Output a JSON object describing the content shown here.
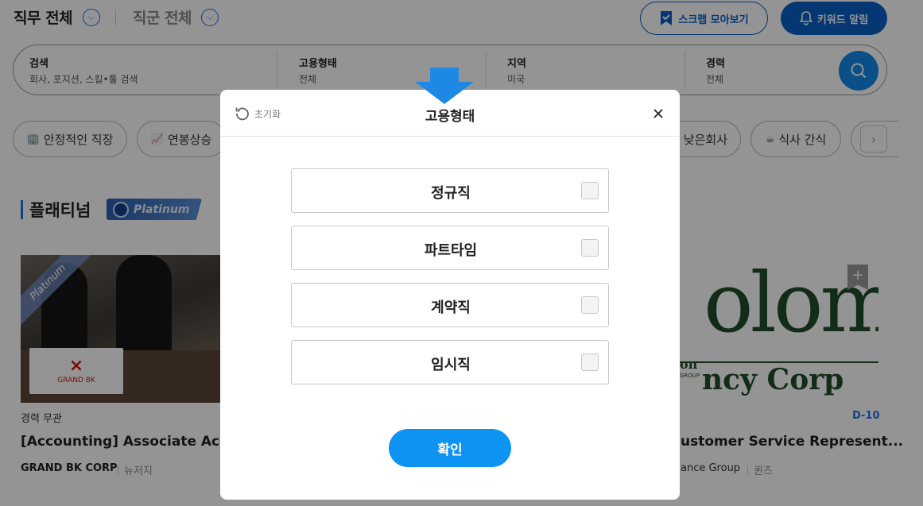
{
  "header": {
    "job_filter": "직무 전체",
    "group_filter": "직군 전체",
    "scrap_button": "스크랩 모아보기",
    "keyword_alarm_button": "키워드 알림"
  },
  "search": {
    "segments": [
      {
        "label": "검색",
        "value": "회사, 포지션, 스킬•툴 검색"
      },
      {
        "label": "고용형태",
        "value": "전체"
      },
      {
        "label": "지역",
        "value": "미국"
      },
      {
        "label": "경력",
        "value": "전체"
      }
    ]
  },
  "chips": [
    {
      "icon": "🏢",
      "label": "안정적인 직장"
    },
    {
      "icon": "📈",
      "label": "연봉상승"
    },
    {
      "icon": "",
      "label": "낮은회사"
    },
    {
      "icon": "☕",
      "label": "식사 간식"
    }
  ],
  "section": {
    "title": "플래티넘",
    "badge": "Platinum"
  },
  "cards": [
    {
      "ribbon": "Platinum",
      "logo_text": "GRAND BK",
      "experience": "경력 무관",
      "title": "[Accounting] Associate Accou",
      "company": "GRAND BK CORP",
      "location": "뉴저지"
    },
    {
      "logo_big": "olom",
      "logo_small_top": "on",
      "logo_small_bottom": "GROUP",
      "logo_sub": "ncy Corp",
      "dday": "D-10",
      "title": "ustomer Service Represent...",
      "company": "ance Group",
      "location": "퀸즈"
    }
  ],
  "modal": {
    "reset_label": "초기화",
    "title": "고용형태",
    "options": [
      {
        "label": "정규직",
        "checked": false
      },
      {
        "label": "파트타임",
        "checked": false
      },
      {
        "label": "계약직",
        "checked": false
      },
      {
        "label": "임시직",
        "checked": false
      }
    ],
    "confirm_label": "확인"
  },
  "colors": {
    "primary": "#0d93f2",
    "brand_blue": "#0a5fc4",
    "overlay": "rgba(0,0,0,0.42)",
    "pointer_arrow": "#1e88e5"
  }
}
